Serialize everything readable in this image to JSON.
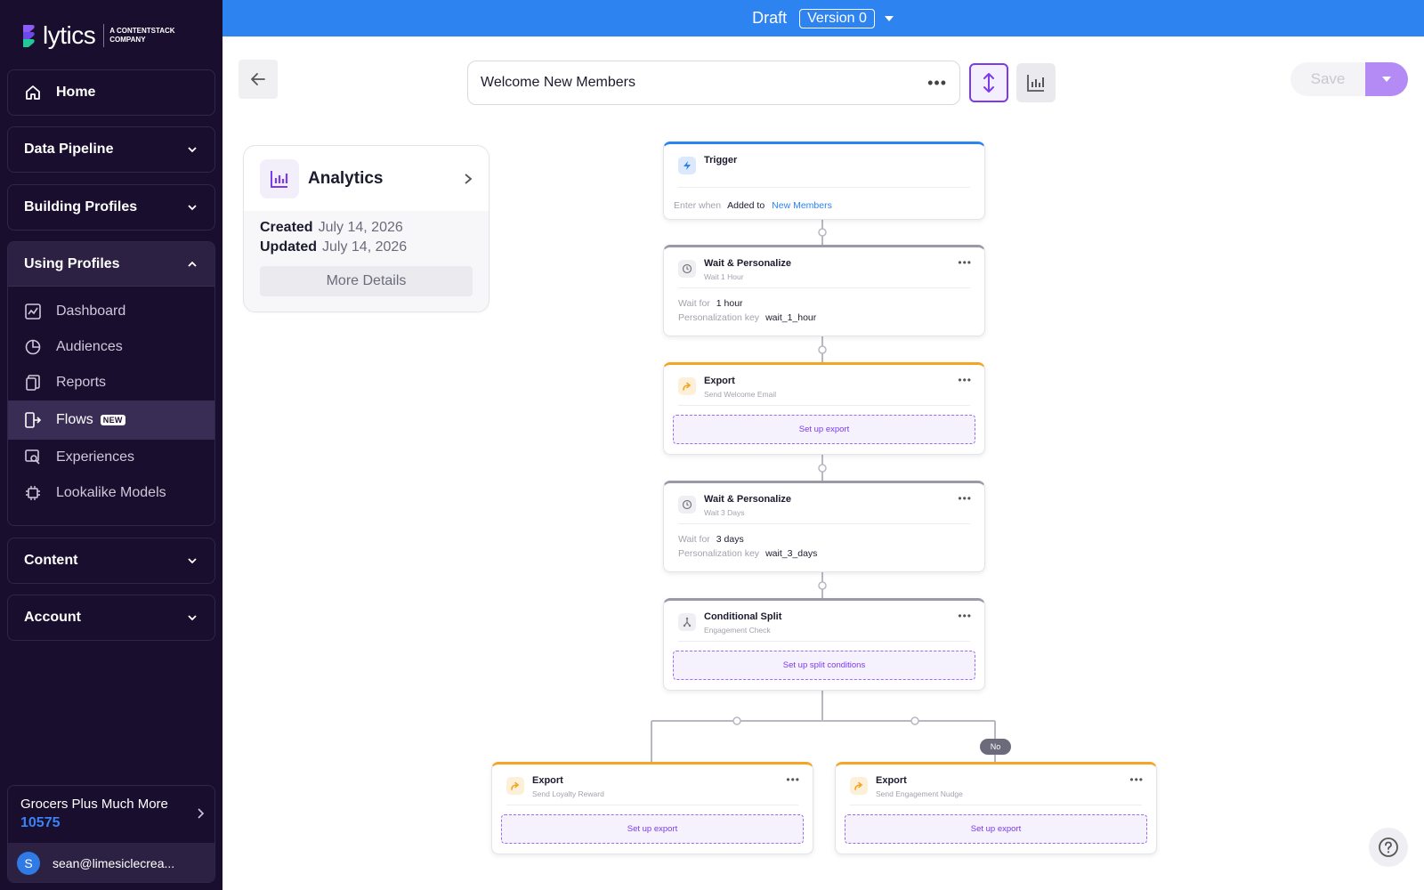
{
  "brand": {
    "wordmark": "lytics",
    "tagline": "A CONTENTSTACK COMPANY"
  },
  "sidebar": {
    "home": "Home",
    "sections": {
      "data_pipeline": "Data Pipeline",
      "building_profiles": "Building Profiles",
      "using_profiles": "Using Profiles",
      "content": "Content",
      "account": "Account"
    },
    "using_profiles_items": [
      {
        "label": "Dashboard",
        "icon": "dashboard-icon"
      },
      {
        "label": "Audiences",
        "icon": "pie-icon"
      },
      {
        "label": "Reports",
        "icon": "reports-icon"
      },
      {
        "label": "Flows",
        "icon": "flows-icon",
        "badge": "NEW",
        "active": true
      },
      {
        "label": "Experiences",
        "icon": "experiences-icon"
      },
      {
        "label": "Lookalike Models",
        "icon": "chip-icon"
      }
    ],
    "org": {
      "name": "Grocers Plus Much More",
      "id": "10575"
    },
    "user": {
      "initial": "S",
      "email": "sean@limesiclecrea..."
    }
  },
  "topbar": {
    "status": "Draft",
    "version": "Version 0"
  },
  "toolbar": {
    "flow_name": "Welcome New Members",
    "save_label": "Save"
  },
  "analytics": {
    "title": "Analytics",
    "created_label": "Created",
    "created_value": "July 14, 2026",
    "updated_label": "Updated",
    "updated_value": "July 14, 2026",
    "more_details": "More Details"
  },
  "flow": {
    "trigger": {
      "title": "Trigger",
      "enter_when": "Enter when",
      "condition": "Added to",
      "audience": "New Members"
    },
    "wait1": {
      "title": "Wait & Personalize",
      "subtitle": "Wait 1 Hour",
      "wait_for_label": "Wait for",
      "wait_for_value": "1 hour",
      "key_label": "Personalization key",
      "key_value": "wait_1_hour"
    },
    "export1": {
      "title": "Export",
      "subtitle": "Send Welcome Email",
      "action": "Set up export"
    },
    "wait2": {
      "title": "Wait & Personalize",
      "subtitle": "Wait 3 Days",
      "wait_for_label": "Wait for",
      "wait_for_value": "3 days",
      "key_label": "Personalization key",
      "key_value": "wait_3_days"
    },
    "split": {
      "title": "Conditional Split",
      "subtitle": "Engagement Check",
      "action": "Set up split conditions"
    },
    "no_label": "No",
    "export_left": {
      "title": "Export",
      "subtitle": "Send Loyalty Reward",
      "action": "Set up export"
    },
    "export_right": {
      "title": "Export",
      "subtitle": "Send Engagement Nudge",
      "action": "Set up export"
    }
  },
  "colors": {
    "sidebar_bg": "#1a0e2e",
    "topbar_bg": "#2d83f0",
    "accent_purple": "#7c3aed",
    "export_orange": "#f5a524"
  }
}
